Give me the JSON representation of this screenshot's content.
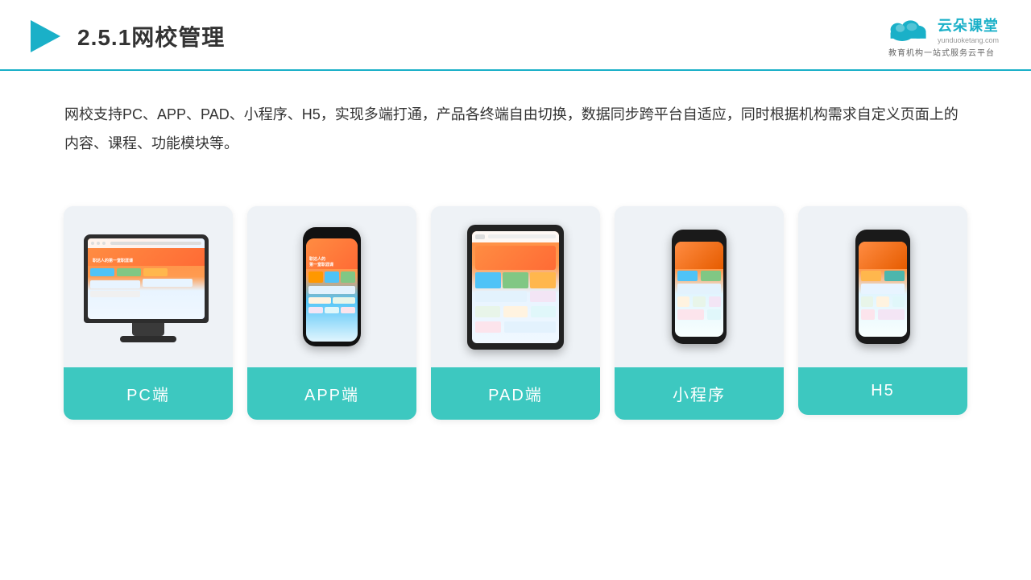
{
  "header": {
    "title": "2.5.1网校管理",
    "logo_main": "云朵课堂",
    "logo_url": "yunduoketang.com",
    "logo_subtitle": "教育机构一站式服务云平台"
  },
  "description": {
    "text": "网校支持PC、APP、PAD、小程序、H5，实现多端打通，产品各终端自由切换，数据同步跨平台自适应，同时根据机构需求自定义页面上的内容、课程、功能模块等。"
  },
  "cards": [
    {
      "id": "pc",
      "label": "PC端"
    },
    {
      "id": "app",
      "label": "APP端"
    },
    {
      "id": "pad",
      "label": "PAD端"
    },
    {
      "id": "miniprogram",
      "label": "小程序"
    },
    {
      "id": "h5",
      "label": "H5"
    }
  ],
  "colors": {
    "accent": "#3dc8c0",
    "header_border": "#1ab0c8",
    "title": "#333333",
    "logo": "#1ab0c8"
  }
}
